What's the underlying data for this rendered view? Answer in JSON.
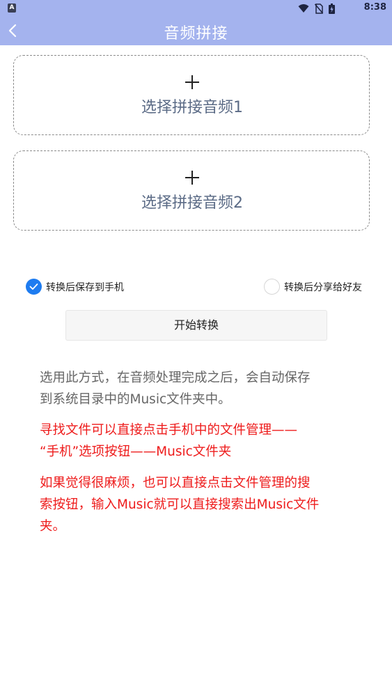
{
  "status_bar": {
    "left_badge": "A",
    "time": "8:38",
    "icons": [
      "wifi-icon",
      "no-sim-icon",
      "battery-charging-icon"
    ]
  },
  "header": {
    "title": "音频拼接",
    "back_icon": "chevron-left-icon"
  },
  "pickers": [
    {
      "label": "选择拼接音频1",
      "icon": "plus-icon"
    },
    {
      "label": "选择拼接音频2",
      "icon": "plus-icon"
    }
  ],
  "options": {
    "save_to_phone": {
      "label": "转换后保存到手机",
      "checked": true
    },
    "share_to_friend": {
      "label": "转换后分享给好友",
      "checked": false
    }
  },
  "start_button": {
    "label": "开始转换"
  },
  "info": {
    "gray_lines": [
      "选用此方式，在音频处理完成之后，会自动保存",
      "到系统目录中的Music文件夹中。"
    ],
    "red1_lines": [
      "寻找文件可以直接点击手机中的文件管理——",
      "“手机”选项按钮——Music文件夹"
    ],
    "red2_lines": [
      "如果觉得很麻烦，也可以直接点击文件管理的搜",
      "索按钮，输入Music就可以直接搜索出Music文件",
      "夹。"
    ]
  },
  "colors": {
    "header_bg": "#a4b3ee",
    "accent_blue": "#1e7cf0",
    "red_text": "#ee1c1c",
    "gray_text": "#666666"
  }
}
